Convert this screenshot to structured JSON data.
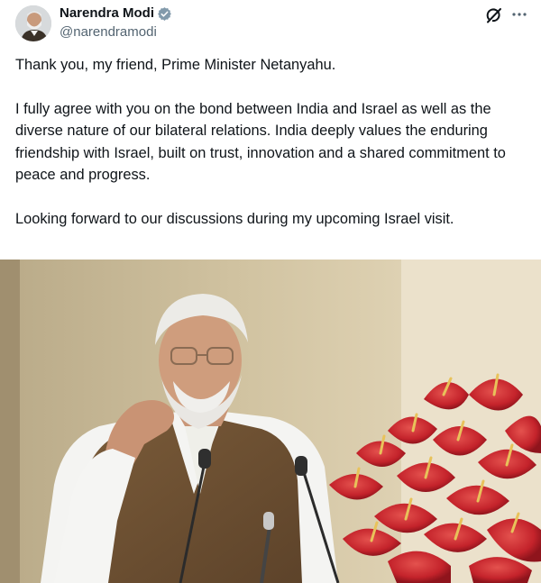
{
  "post": {
    "author": {
      "display_name": "Narendra Modi",
      "handle": "@narendramodi",
      "verified": true
    },
    "text": {
      "p1": "Thank you, my friend, Prime Minister Netanyahu.",
      "p2": "I fully agree with you on the bond between India and Israel as well as the diverse nature of our bilateral relations. India deeply values the enduring friendship with Israel, built on trust, innovation and a shared commitment to peace and progress.",
      "p3": "Looking forward to our discussions during my upcoming Israel visit."
    },
    "icons": {
      "verified": "verified-badge-icon",
      "grok": "grok-icon",
      "more": "more-icon"
    },
    "colors": {
      "text": "#0f1419",
      "secondary_text": "#536471",
      "verified_badge": "#829aab"
    }
  }
}
